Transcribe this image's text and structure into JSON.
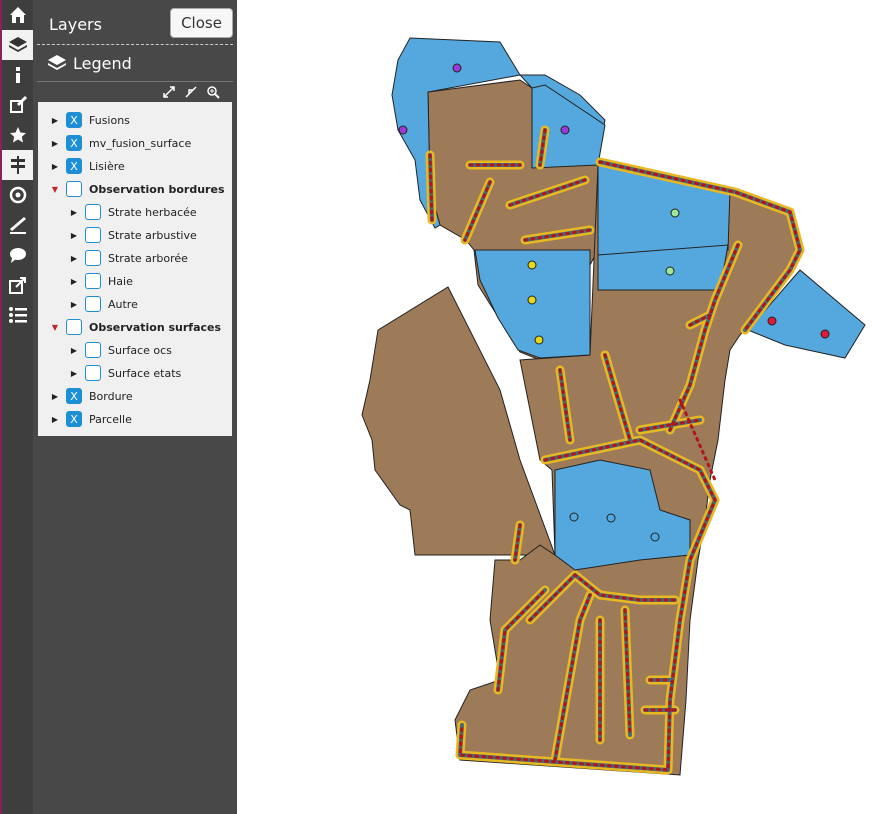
{
  "panel": {
    "title": "Layers",
    "close_label": "Close",
    "legend_title": "Legend"
  },
  "toolbar": {
    "tools": [
      "home-icon",
      "layers-icon",
      "info-icon",
      "edit-icon",
      "star-icon",
      "signpost-icon",
      "target-icon",
      "measure-icon",
      "comment-icon",
      "share-icon",
      "list-icon"
    ]
  },
  "layers": [
    {
      "label": "Fusions",
      "checked": true,
      "bold": false,
      "expanded": false
    },
    {
      "label": "mv_fusion_surface",
      "checked": true,
      "bold": false,
      "expanded": false
    },
    {
      "label": "Lisière",
      "checked": true,
      "bold": false,
      "expanded": false
    },
    {
      "label": "Observation bordures",
      "checked": false,
      "bold": true,
      "expanded": true
    },
    {
      "label": "Strate herbacée",
      "checked": false,
      "bold": false,
      "expanded": false
    },
    {
      "label": "Strate arbustive",
      "checked": false,
      "bold": false,
      "expanded": false
    },
    {
      "label": "Strate arborée",
      "checked": false,
      "bold": false,
      "expanded": false
    },
    {
      "label": "Haie",
      "checked": false,
      "bold": false,
      "expanded": false
    },
    {
      "label": "Autre",
      "checked": false,
      "bold": false,
      "expanded": false
    },
    {
      "label": "Observation surfaces",
      "checked": false,
      "bold": true,
      "expanded": true
    },
    {
      "label": "Surface ocs",
      "checked": false,
      "bold": false,
      "expanded": false
    },
    {
      "label": "Surface etats",
      "checked": false,
      "bold": false,
      "expanded": false
    },
    {
      "label": "Bordure",
      "checked": true,
      "bold": false,
      "expanded": false
    },
    {
      "label": "Parcelle",
      "checked": true,
      "bold": false,
      "expanded": false
    }
  ],
  "colors": {
    "parcel": "#9e7b58",
    "fusion": "#55a8dd",
    "border_line": "#e8b820",
    "border_dot": "#b0151b",
    "checkbox": "#1d8fd6"
  }
}
